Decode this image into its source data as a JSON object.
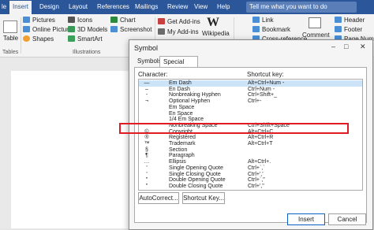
{
  "menubar": {
    "tabs": [
      "le",
      "Insert",
      "Design",
      "Layout",
      "References",
      "Mailings",
      "Review",
      "View",
      "Help"
    ],
    "search_placeholder": "Tell me what you want to do"
  },
  "ribbon": {
    "table_label": "Table",
    "tables_group": "Tables",
    "pictures": "Pictures",
    "online_pictures": "Online Pictures",
    "shapes": "Shapes",
    "icons": "Icons",
    "models3d": "3D Models",
    "smartart": "SmartArt",
    "illustrations_group": "Illustrations",
    "chart": "Chart",
    "screenshot": "Screenshot",
    "get_addins": "Get Add-ins",
    "my_addins": "My Add-ins",
    "wikipedia": "Wikipedia",
    "link": "Link",
    "bookmark": "Bookmark",
    "crossref": "Cross-reference",
    "comment": "Comment",
    "header": "Header",
    "footer": "Footer",
    "pagenumber": "Page Number"
  },
  "dialog": {
    "title": "Symbol",
    "tabs": [
      "Symbols",
      "Special Characters"
    ],
    "character_label": "Character:",
    "shortcut_label": "Shortcut key:",
    "rows": [
      {
        "char": "—",
        "name": "Em Dash",
        "key": "Alt+Ctrl+Num -"
      },
      {
        "char": "–",
        "name": "En Dash",
        "key": "Ctrl+Num -"
      },
      {
        "char": "‑",
        "name": "Nonbreaking Hyphen",
        "key": "Ctrl+Shift+_"
      },
      {
        "char": "¬",
        "name": "Optional Hyphen",
        "key": "Ctrl+-"
      },
      {
        "char": "",
        "name": "Em Space",
        "key": ""
      },
      {
        "char": "",
        "name": "En Space",
        "key": ""
      },
      {
        "char": "",
        "name": "1/4 Em Space",
        "key": ""
      },
      {
        "char": "°",
        "name": "Nonbreaking Space",
        "key": "Ctrl+Shift+Space"
      },
      {
        "char": "©",
        "name": "Copyright",
        "key": "Alt+Ctrl+C"
      },
      {
        "char": "®",
        "name": "Registered",
        "key": "Alt+Ctrl+R"
      },
      {
        "char": "™",
        "name": "Trademark",
        "key": "Alt+Ctrl+T"
      },
      {
        "char": "§",
        "name": "Section",
        "key": ""
      },
      {
        "char": "¶",
        "name": "Paragraph",
        "key": ""
      },
      {
        "char": "…",
        "name": "Ellipsis",
        "key": "Alt+Ctrl+."
      },
      {
        "char": "'",
        "name": "Single Opening Quote",
        "key": "Ctrl+`,`"
      },
      {
        "char": "'",
        "name": "Single Closing Quote",
        "key": "Ctrl+','"
      },
      {
        "char": "\"",
        "name": "Double Opening Quote",
        "key": "Ctrl+`,\""
      },
      {
        "char": "\"",
        "name": "Double Closing Quote",
        "key": "Ctrl+',\""
      }
    ],
    "autocorrect_btn": "AutoCorrect...",
    "shortcut_btn": "Shortcut Key...",
    "insert_btn": "Insert",
    "cancel_btn": "Cancel"
  },
  "colors": {
    "word_blue": "#2b579a",
    "highlight_red": "#e11b22",
    "selection": "#cde3f7"
  }
}
